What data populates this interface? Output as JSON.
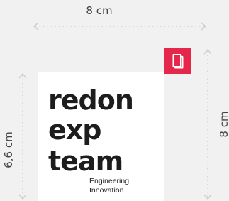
{
  "dimensions": {
    "width_label": "8 cm",
    "left_height_label": "6,6 cm",
    "right_height_label": "8 cm"
  },
  "sticker": {
    "line1": "redon",
    "line2": "exp",
    "line3": "team",
    "tagline1": "Engineering",
    "tagline2": "Innovation"
  },
  "badge": {
    "color": "#e4274a",
    "icon": "pages-icon"
  },
  "colors": {
    "background": "#f1f1f1",
    "dimension_lines": "#cfcfcf",
    "text": "#1d1d1d"
  }
}
